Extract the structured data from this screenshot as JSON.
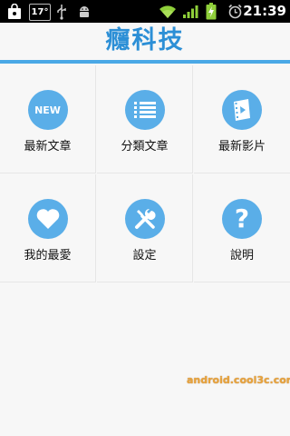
{
  "status_bar": {
    "temperature": "17°",
    "time": "21:39",
    "icons": [
      "shopping-bag-icon",
      "usb-icon",
      "android-debug-icon",
      "wifi-icon",
      "signal-icon",
      "battery-charging-icon",
      "alarm-icon"
    ]
  },
  "app": {
    "title": "癮科技",
    "accent_color": "#2c8fd6",
    "icon_color": "#5aaee8"
  },
  "menu": {
    "items": [
      {
        "label": "最新文章",
        "icon": "new-badge-icon",
        "icon_text": "NEW"
      },
      {
        "label": "分類文章",
        "icon": "list-icon"
      },
      {
        "label": "最新影片",
        "icon": "video-icon"
      },
      {
        "label": "我的最愛",
        "icon": "heart-icon"
      },
      {
        "label": "設定",
        "icon": "tools-icon"
      },
      {
        "label": "說明",
        "icon": "help-icon"
      }
    ]
  },
  "watermark": "android.cool3c.com"
}
